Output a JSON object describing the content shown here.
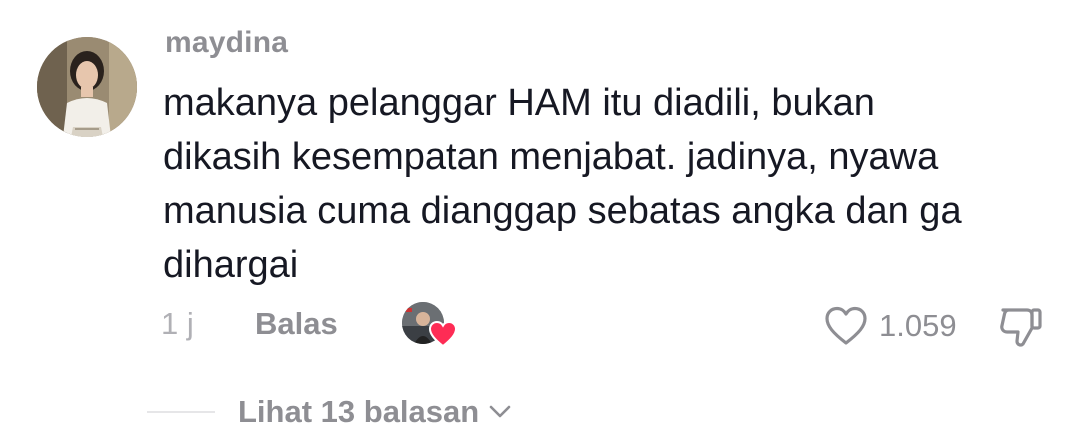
{
  "comment": {
    "username": "maydina",
    "text_lines": [
      "makanya pelanggar HAM itu diadili, bukan",
      "dikasih kesempatan menjabat. jadinya, nyawa",
      "manusia cuma dianggap sebatas angka dan ga",
      "dihargai"
    ],
    "time": "1 j",
    "reply_label": "Balas",
    "like_count": "1.059",
    "liked_by_creator": true,
    "view_replies_label": "Lihat 13 balasan"
  },
  "icons": {
    "avatar": "user-avatar-photo",
    "creator_avatar": "creator-avatar-photo",
    "creator_heart": "heart-filled-icon",
    "like": "heart-outline-icon",
    "dislike": "thumbs-down-outline-icon",
    "expand": "chevron-down-icon"
  },
  "colors": {
    "text_primary": "#161823",
    "text_secondary": "#8e8e93",
    "text_muted": "#b0b0b5",
    "creator_heart": "#fe2c55"
  }
}
